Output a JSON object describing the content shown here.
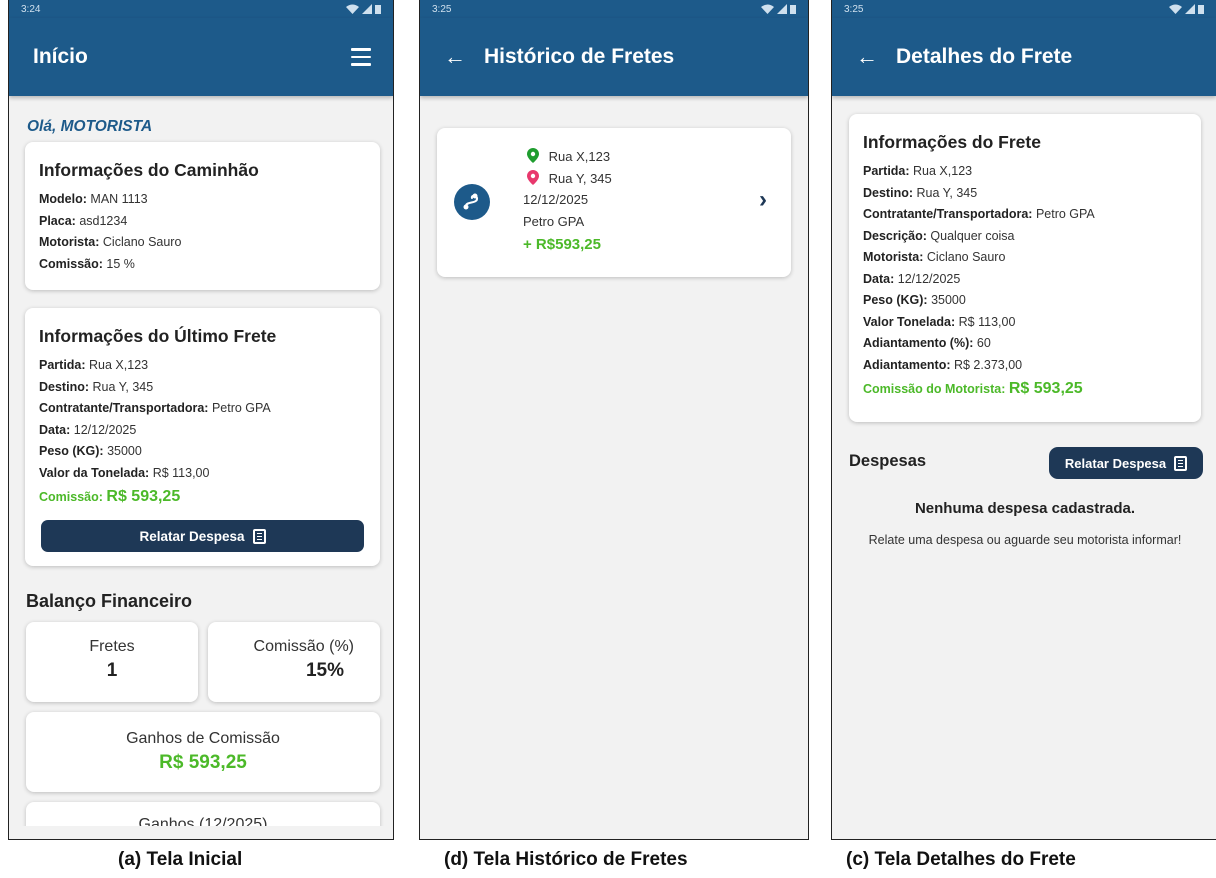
{
  "screen1": {
    "status_time": "3:24",
    "title": "Início",
    "greeting": "Olá, MOTORISTA",
    "truck_card": {
      "title": "Informações do Caminhão",
      "rows": [
        {
          "label": "Modelo:",
          "value": "MAN 1113"
        },
        {
          "label": "Placa:",
          "value": "asd1234"
        },
        {
          "label": "Motorista:",
          "value": "Ciclano Sauro"
        },
        {
          "label": "Comissão:",
          "value": "15 %"
        }
      ]
    },
    "last_freight_card": {
      "title": "Informações do Último Frete",
      "rows": [
        {
          "label": "Partida:",
          "value": "Rua X,123"
        },
        {
          "label": "Destino:",
          "value": "Rua Y, 345"
        },
        {
          "label": "Contratante/Transportadora:",
          "value": "Petro GPA"
        },
        {
          "label": "Data:",
          "value": "12/12/2025"
        },
        {
          "label": "Peso (KG):",
          "value": "35000"
        },
        {
          "label": "Valor da Tonelada:",
          "value": "R$ 113,00"
        }
      ],
      "commission_label": "Comissão:",
      "commission_value": "R$ 593,25",
      "button": "Relatar Despesa"
    },
    "balance_title": "Balanço Financeiro",
    "stats": {
      "fretes_label": "Fretes",
      "fretes_value": "1",
      "comissao_label": "Comissão (%)",
      "comissao_value": "15%",
      "ganhos_label": "Ganhos de Comissão",
      "ganhos_value": "R$ 593,25",
      "partial_label": "Ganhos (12/2025)"
    },
    "caption": "(a) Tela Inicial"
  },
  "screen2": {
    "status_time": "3:25",
    "title": "Histórico de Fretes",
    "item": {
      "origin": "Rua X,123",
      "destination": "Rua Y, 345",
      "date": "12/12/2025",
      "company": "Petro GPA",
      "amount": "+ R$593,25"
    },
    "caption": "(d) Tela Histórico de Fretes"
  },
  "screen3": {
    "status_time": "3:25",
    "title": "Detalhes do Frete",
    "info_card": {
      "title": "Informações do Frete",
      "rows": [
        {
          "label": "Partida:",
          "value": "Rua X,123"
        },
        {
          "label": "Destino:",
          "value": "Rua Y, 345"
        },
        {
          "label": "Contratante/Transportadora:",
          "value": "Petro GPA"
        },
        {
          "label": "Descrição:",
          "value": "Qualquer coisa"
        },
        {
          "label": "Motorista:",
          "value": "Ciclano Sauro"
        },
        {
          "label": "Data:",
          "value": "12/12/2025"
        },
        {
          "label": "Peso (KG):",
          "value": "35000"
        },
        {
          "label": "Valor Tonelada:",
          "value": "R$ 113,00"
        },
        {
          "label": "Adiantamento (%):",
          "value": "60"
        },
        {
          "label": "Adiantamento:",
          "value": "R$ 2.373,00"
        }
      ],
      "commission_label": "Comissão do Motorista:",
      "commission_value": "R$ 593,25"
    },
    "expenses_title": "Despesas",
    "button": "Relatar Despesa",
    "empty_title": "Nenhuma despesa cadastrada.",
    "empty_text": "Relate uma despesa ou aguarde seu motorista informar!",
    "caption": "(c) Tela Detalhes do Frete"
  },
  "colors": {
    "appbar": "#1d5a8a",
    "button_dark": "#1e3856",
    "accent_green": "#4cb929",
    "pin_green": "#1f9d2f",
    "pin_red": "#e8386d"
  }
}
